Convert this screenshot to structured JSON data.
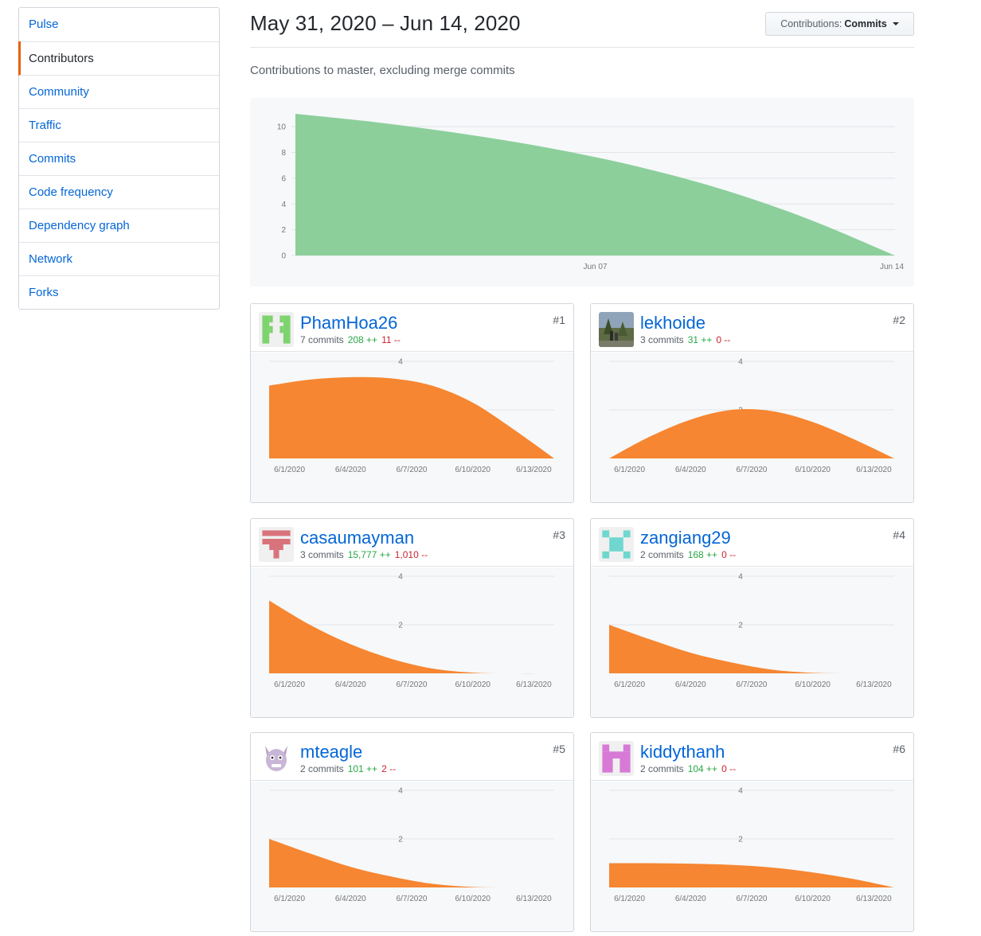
{
  "sidebar": {
    "items": [
      {
        "label": "Pulse"
      },
      {
        "label": "Contributors"
      },
      {
        "label": "Community"
      },
      {
        "label": "Traffic"
      },
      {
        "label": "Commits"
      },
      {
        "label": "Code frequency"
      },
      {
        "label": "Dependency graph"
      },
      {
        "label": "Network"
      },
      {
        "label": "Forks"
      }
    ],
    "selected": "Contributors"
  },
  "header": {
    "date_range": "May 31, 2020 – Jun 14, 2020",
    "select_label": "Contributions:",
    "select_value": "Commits",
    "subtitle": "Contributions to master, excluding merge commits"
  },
  "colors": {
    "overview_fill": "#8ccf9b",
    "contributor_fill": "#f68631",
    "link": "#0366d6",
    "additions": "#28a745",
    "deletions": "#cb2431",
    "selected_accent": "#e36209"
  },
  "chart_data": [
    {
      "type": "area",
      "yticks": [
        "0",
        "2",
        "4",
        "6",
        "8",
        "10"
      ],
      "xticks": [
        "Jun 07",
        "Jun 14"
      ],
      "ylim": [
        0,
        11
      ],
      "x": [
        "2020-05-31",
        "2020-06-02",
        "2020-06-04",
        "2020-06-06",
        "2020-06-08",
        "2020-06-10",
        "2020-06-12",
        "2020-06-14"
      ],
      "values": [
        11,
        10.3,
        9.4,
        8.3,
        6.9,
        5.1,
        2.8,
        0
      ],
      "color": "#8ccf9b",
      "grid": true
    },
    {
      "type": "area",
      "yticks": [
        "4",
        "2"
      ],
      "xticks": [
        "6/1/2020",
        "6/4/2020",
        "6/7/2020",
        "6/10/2020",
        "6/13/2020"
      ],
      "ylim": [
        0,
        4
      ],
      "x": [
        "2020-05-31",
        "2020-06-02",
        "2020-06-04",
        "2020-06-06",
        "2020-06-08",
        "2020-06-10",
        "2020-06-12",
        "2020-06-14"
      ],
      "values": [
        3,
        3.25,
        3.35,
        3.3,
        3.0,
        2.3,
        1.2,
        0
      ],
      "color": "#f68631"
    },
    {
      "type": "area",
      "yticks": [
        "4",
        "2"
      ],
      "xticks": [
        "6/1/2020",
        "6/4/2020",
        "6/7/2020",
        "6/10/2020",
        "6/13/2020"
      ],
      "ylim": [
        0,
        4
      ],
      "x": [
        "2020-05-31",
        "2020-06-02",
        "2020-06-04",
        "2020-06-06",
        "2020-06-08",
        "2020-06-10",
        "2020-06-12",
        "2020-06-14"
      ],
      "values": [
        0,
        0.9,
        1.6,
        2.0,
        1.95,
        1.5,
        0.8,
        0
      ],
      "color": "#f68631"
    },
    {
      "type": "area",
      "yticks": [
        "4",
        "2"
      ],
      "xticks": [
        "6/1/2020",
        "6/4/2020",
        "6/7/2020",
        "6/10/2020",
        "6/13/2020"
      ],
      "ylim": [
        0,
        4
      ],
      "x": [
        "2020-05-31",
        "2020-06-02",
        "2020-06-04",
        "2020-06-06",
        "2020-06-08",
        "2020-06-10",
        "2020-06-12",
        "2020-06-14"
      ],
      "values": [
        3,
        2.0,
        1.2,
        0.6,
        0.2,
        0.03,
        0,
        0
      ],
      "color": "#f68631"
    },
    {
      "type": "area",
      "yticks": [
        "4",
        "2"
      ],
      "xticks": [
        "6/1/2020",
        "6/4/2020",
        "6/7/2020",
        "6/10/2020",
        "6/13/2020"
      ],
      "ylim": [
        0,
        4
      ],
      "x": [
        "2020-05-31",
        "2020-06-02",
        "2020-06-04",
        "2020-06-06",
        "2020-06-08",
        "2020-06-10",
        "2020-06-12",
        "2020-06-14"
      ],
      "values": [
        2,
        1.4,
        0.85,
        0.45,
        0.15,
        0.02,
        0,
        0
      ],
      "color": "#f68631"
    },
    {
      "type": "area",
      "yticks": [
        "4",
        "2"
      ],
      "xticks": [
        "6/1/2020",
        "6/4/2020",
        "6/7/2020",
        "6/10/2020",
        "6/13/2020"
      ],
      "ylim": [
        0,
        4
      ],
      "x": [
        "2020-05-31",
        "2020-06-02",
        "2020-06-04",
        "2020-06-06",
        "2020-06-08",
        "2020-06-10",
        "2020-06-12",
        "2020-06-14"
      ],
      "values": [
        2,
        1.4,
        0.85,
        0.45,
        0.15,
        0.02,
        0,
        0
      ],
      "color": "#f68631"
    },
    {
      "type": "area",
      "yticks": [
        "4",
        "2"
      ],
      "xticks": [
        "6/1/2020",
        "6/4/2020",
        "6/7/2020",
        "6/10/2020",
        "6/13/2020"
      ],
      "ylim": [
        0,
        4
      ],
      "x": [
        "2020-05-31",
        "2020-06-02",
        "2020-06-04",
        "2020-06-06",
        "2020-06-08",
        "2020-06-10",
        "2020-06-12",
        "2020-06-14"
      ],
      "values": [
        1,
        1.0,
        0.98,
        0.93,
        0.82,
        0.62,
        0.35,
        0
      ],
      "color": "#f68631"
    }
  ],
  "contributors": [
    {
      "rank": "#1",
      "name": "PhamHoa26",
      "commits": "7 commits",
      "additions": "208 ++",
      "deletions": "11 --",
      "avatar_icon": "identicon-green",
      "avatar_color": "#7ed36e"
    },
    {
      "rank": "#2",
      "name": "lekhoide",
      "commits": "3 commits",
      "additions": "31 ++",
      "deletions": "0 --",
      "avatar_icon": "photo-avatar",
      "avatar_color": "#6d7f4e"
    },
    {
      "rank": "#3",
      "name": "casaumayman",
      "commits": "3 commits",
      "additions": "15,777 ++",
      "deletions": "1,010 --",
      "avatar_icon": "identicon-red",
      "avatar_color": "#d9737b"
    },
    {
      "rank": "#4",
      "name": "zangiang29",
      "commits": "2 commits",
      "additions": "168 ++",
      "deletions": "0 --",
      "avatar_icon": "identicon-teal",
      "avatar_color": "#6fd7cf"
    },
    {
      "rank": "#5",
      "name": "mteagle",
      "commits": "2 commits",
      "additions": "101 ++",
      "deletions": "2 --",
      "avatar_icon": "monster-avatar",
      "avatar_color": "#b9a3c7"
    },
    {
      "rank": "#6",
      "name": "kiddythanh",
      "commits": "2 commits",
      "additions": "104 ++",
      "deletions": "0 --",
      "avatar_icon": "identicon-pink",
      "avatar_color": "#d77ad6"
    }
  ]
}
